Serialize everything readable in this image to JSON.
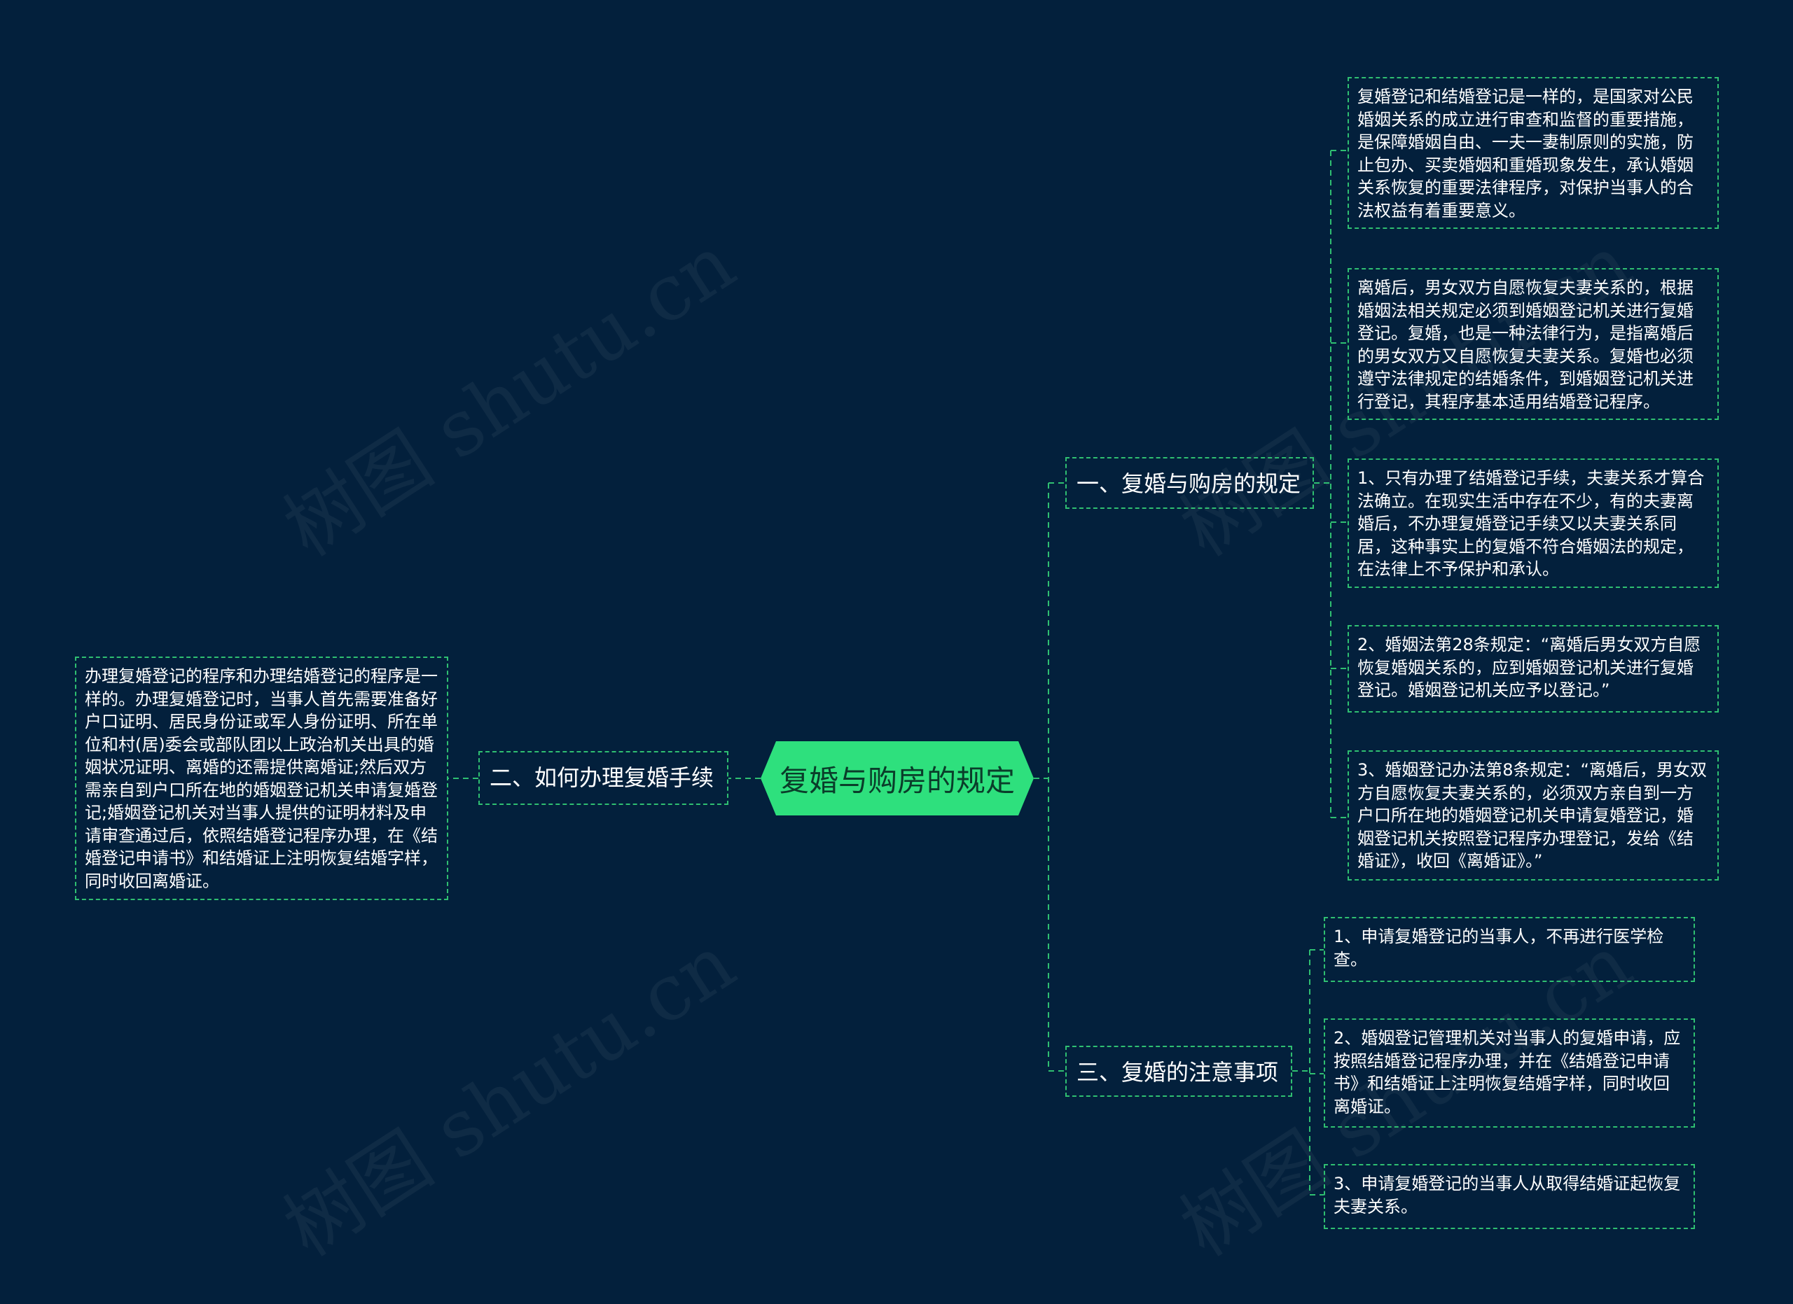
{
  "root": {
    "label": "复婚与购房的规定"
  },
  "branches": {
    "b1": {
      "label": "一、复婚与购房的规定",
      "leaves": [
        "复婚登记和结婚登记是一样的，是国家对公民婚姻关系的成立进行审查和监督的重要措施，是保障婚姻自由、一夫一妻制原则的实施，防止包办、买卖婚姻和重婚现象发生，承认婚姻关系恢复的重要法律程序，对保护当事人的合法权益有着重要意义。",
        "离婚后，男女双方自愿恢复夫妻关系的，根据婚姻法相关规定必须到婚姻登记机关进行复婚登记。复婚，也是一种法律行为，是指离婚后的男女双方又自愿恢复夫妻关系。复婚也必须遵守法律规定的结婚条件，到婚姻登记机关进行登记，其程序基本适用结婚登记程序。",
        "1、只有办理了结婚登记手续，夫妻关系才算合法确立。在现实生活中存在不少，有的夫妻离婚后，不办理复婚登记手续又以夫妻关系同居，这种事实上的复婚不符合婚姻法的规定，在法律上不予保护和承认。",
        "2、婚姻法第28条规定：“离婚后男女双方自愿恢复婚姻关系的，应到婚姻登记机关进行复婚登记。婚姻登记机关应予以登记。”",
        "3、婚姻登记办法第8条规定：“离婚后，男女双方自愿恢复夫妻关系的，必须双方亲自到一方户口所在地的婚姻登记机关申请复婚登记，婚姻登记机关按照登记程序办理登记，发给《结婚证》，收回《离婚证》。”"
      ]
    },
    "b2": {
      "label": "二、如何办理复婚手续",
      "leaves": [
        "办理复婚登记的程序和办理结婚登记的程序是一样的。办理复婚登记时，当事人首先需要准备好户口证明、居民身份证或军人身份证明、所在单位和村(居)委会或部队团以上政治机关出具的婚姻状况证明、离婚的还需提供离婚证;然后双方需亲自到户口所在地的婚姻登记机关申请复婚登记;婚姻登记机关对当事人提供的证明材料及申请审查通过后，依照结婚登记程序办理，在《结婚登记申请书》和结婚证上注明恢复结婚字样，同时收回离婚证。"
      ]
    },
    "b3": {
      "label": "三、复婚的注意事项",
      "leaves": [
        "1、申请复婚登记的当事人，不再进行医学检查。",
        "2、婚姻登记管理机关对当事人的复婚申请，应按照结婚登记程序办理，并在《结婚登记申请书》和结婚证上注明恢复结婚字样，同时收回离婚证。",
        "3、申请复婚登记的当事人从取得结婚证起恢复夫妻关系。"
      ]
    }
  },
  "watermark": "树图 shutu.cn",
  "colors": {
    "background": "#03203c",
    "accent": "#2ee07d",
    "border": "#2fbf71"
  }
}
